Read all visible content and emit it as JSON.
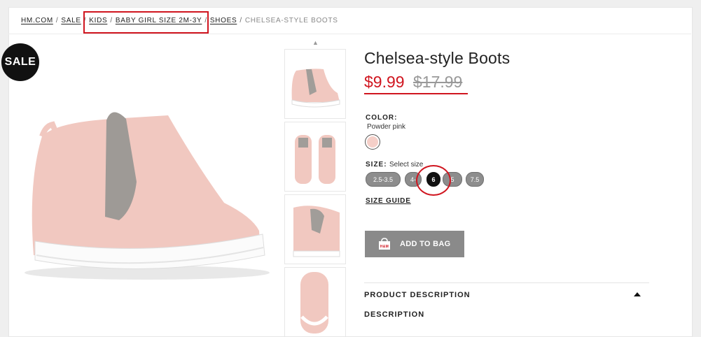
{
  "breadcrumb": {
    "items": [
      "HM.COM",
      "SALE",
      "KIDS",
      "BABY GIRL SIZE 2M-3Y",
      "SHOES"
    ],
    "current": "CHELSEA-STYLE BOOTS",
    "separator": "/"
  },
  "badge": {
    "label": "SALE"
  },
  "product": {
    "title": "Chelsea-style Boots",
    "price_now": "$9.99",
    "price_old": "$17.99"
  },
  "color": {
    "label": "COLOR:",
    "value": "Powder pink",
    "swatch": "#f5cfc8"
  },
  "size": {
    "label": "SIZE:",
    "hint": "Select size",
    "options": [
      "2.5-3.5",
      "4-5",
      "6",
      "6.5",
      "7.5"
    ],
    "options_visible": [
      "2.5-3.5",
      "4-",
      "6",
      "5",
      "7.5"
    ],
    "selected": "6"
  },
  "size_guide": "SIZE GUIDE",
  "add_to_bag": {
    "label": "ADD TO BAG",
    "bag_text": "H&M"
  },
  "description": {
    "heading": "PRODUCT DESCRIPTION",
    "sub": "DESCRIPTION"
  },
  "colors": {
    "accent_red": "#d0151f",
    "button_gray": "#8a8a8a"
  }
}
